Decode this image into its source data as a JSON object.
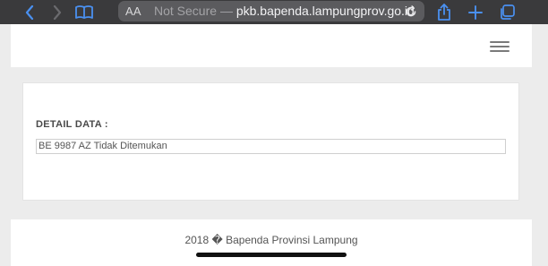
{
  "browser": {
    "text_size_button": "AA",
    "security_label": "Not Secure",
    "separator": "—",
    "domain": "pkb.bapenda.lampungprov.go.id"
  },
  "content": {
    "detail_label": "DETAIL DATA :",
    "detail_value": "BE 9987 AZ Tidak Ditemukan"
  },
  "footer": {
    "copyright": "2018 � Bapenda Provinsi Lampung"
  }
}
